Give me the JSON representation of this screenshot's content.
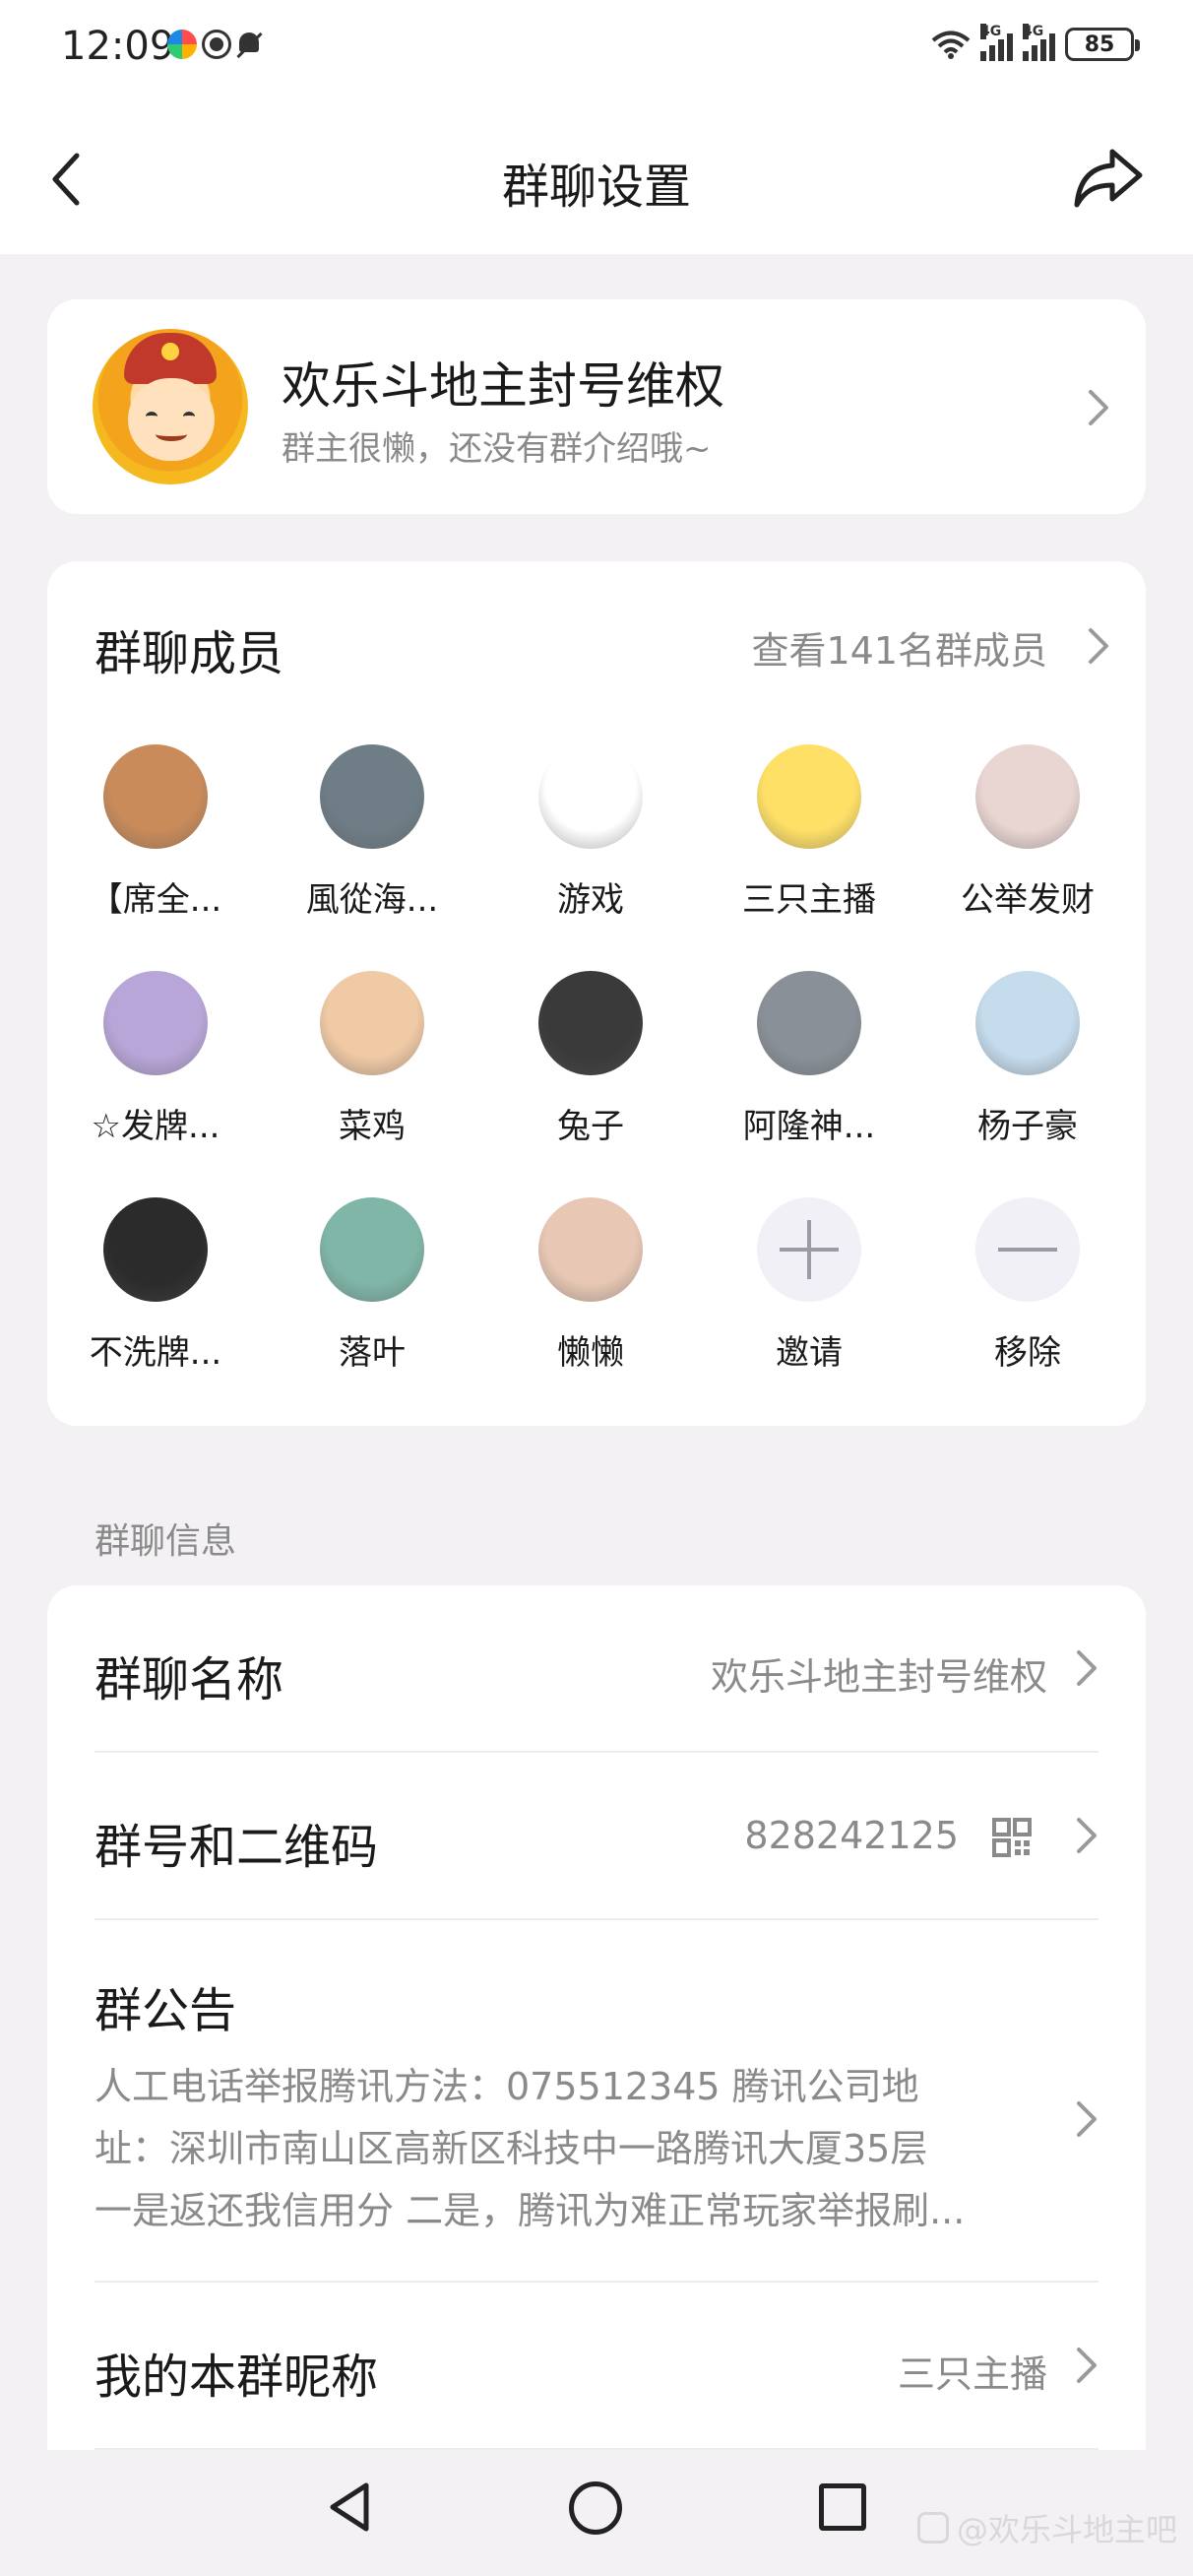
{
  "status_bar": {
    "time": "12:09",
    "network_1": "4G",
    "network_2": "4G",
    "battery": "85"
  },
  "header": {
    "title": "群聊设置"
  },
  "group": {
    "name": "欢乐斗地主封号维权",
    "description": "群主很懒，还没有群介绍哦~"
  },
  "members": {
    "title": "群聊成员",
    "view_all": "查看141名群成员",
    "list": [
      {
        "name": "【席全...",
        "color": "#c98b5a"
      },
      {
        "name": "風從海...",
        "color": "#6f7d86"
      },
      {
        "name": "游戏",
        "color": "#ffffff"
      },
      {
        "name": "三只主播",
        "color": "#ffe066"
      },
      {
        "name": "公举发财",
        "color": "#e9d6d2"
      },
      {
        "name": "☆发牌...",
        "color": "#b9a6d9"
      },
      {
        "name": "菜鸡",
        "color": "#f0c9a5"
      },
      {
        "name": "兔子",
        "color": "#3a3a3a"
      },
      {
        "name": "阿隆神...",
        "color": "#8a9098"
      },
      {
        "name": "杨子豪",
        "color": "#c5dced"
      },
      {
        "name": "不洗牌...",
        "color": "#2b2b2b"
      },
      {
        "name": "落叶",
        "color": "#7fb6a8"
      },
      {
        "name": "懒懒",
        "color": "#e8c8b4"
      }
    ],
    "invite_label": "邀请",
    "remove_label": "移除"
  },
  "info": {
    "section_label": "群聊信息",
    "name_label": "群聊名称",
    "name_value": "欢乐斗地主封号维权",
    "id_label": "群号和二维码",
    "id_value": "828242125",
    "notice_label": "群公告",
    "notice_line1": "人工电话举报腾讯方法：075512345 腾讯公司地",
    "notice_line2": "址：深圳市南山区高新区科技中一路腾讯大厦35层",
    "notice_line3": "一是返还我信用分 二是，腾讯为难正常玩家举报刷...",
    "nickname_label": "我的本群昵称",
    "nickname_value": "三只主播"
  },
  "watermark": "@欢乐斗地主吧"
}
